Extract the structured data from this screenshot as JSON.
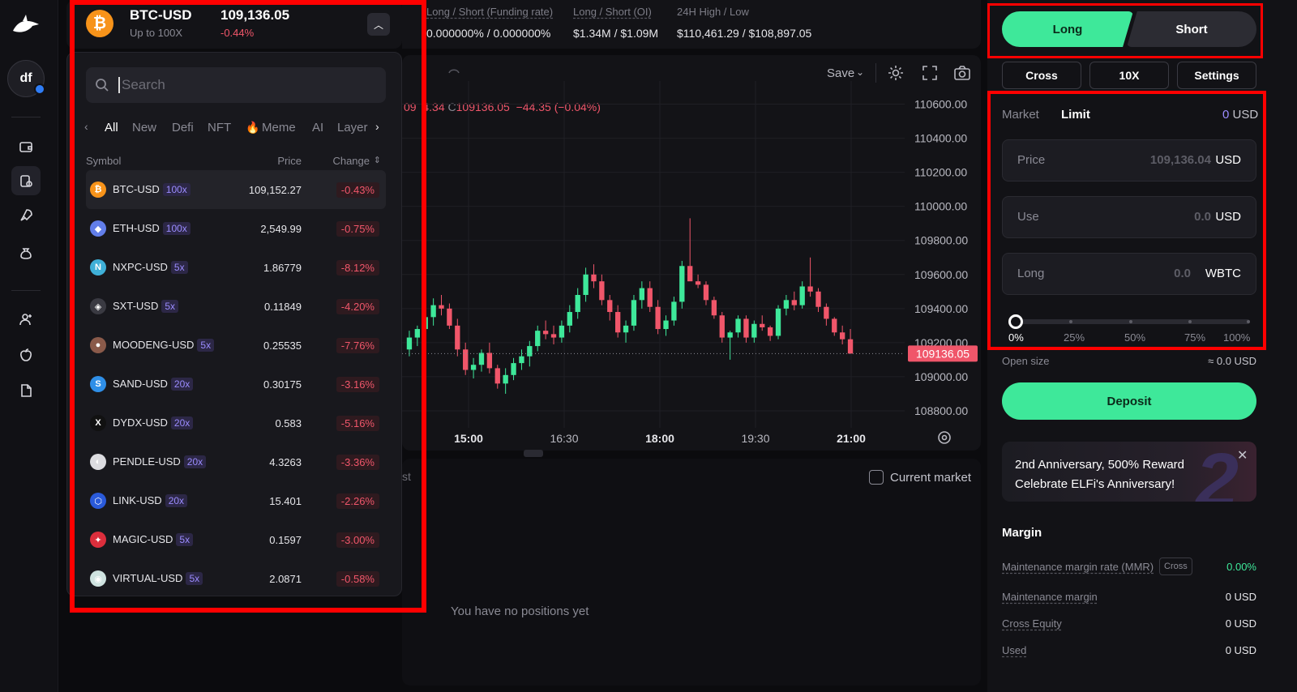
{
  "ticker": {
    "pair": "BTC-USD",
    "leverage": "Up to 100X",
    "price": "109,136.05",
    "change": "-0.44%",
    "coin_glyph": "₿"
  },
  "stats": [
    {
      "label": "Long / Short (Funding rate)",
      "value": "0.000000% / 0.000000%"
    },
    {
      "label": "Long / Short (OI)",
      "value": "$1.34M / $1.09M"
    },
    {
      "label": "24H High / Low",
      "value": "$110,461.29 / $108,897.05"
    }
  ],
  "chart": {
    "save_label": "Save",
    "ohlc_prefix": "09",
    "ohlc_low": "4.34",
    "ohlc_close_label": "C",
    "ohlc_close": "109136.05",
    "ohlc_delta": "−44.35 (−0.04%)",
    "last_price_tag": "109136.05"
  },
  "chart_data": {
    "type": "candlestick",
    "y_ticks": [
      "110600.00",
      "110400.00",
      "110200.00",
      "110000.00",
      "109800.00",
      "109600.00",
      "109400.00",
      "109200.00",
      "109000.00",
      "108800.00"
    ],
    "ylim": [
      108700,
      110650
    ],
    "x_ticks": [
      "15:00",
      "16:30",
      "18:00",
      "19:30",
      "21:00"
    ],
    "last_price": 109136.05,
    "candles": [
      [
        109160,
        109270,
        109120,
        109230
      ],
      [
        109230,
        109300,
        109180,
        109280
      ],
      [
        109280,
        109390,
        109240,
        109350
      ],
      [
        109350,
        109460,
        109300,
        109420
      ],
      [
        109420,
        109480,
        109360,
        109400
      ],
      [
        109400,
        109430,
        109280,
        109300
      ],
      [
        109300,
        109340,
        109120,
        109160
      ],
      [
        109160,
        109200,
        109010,
        109040
      ],
      [
        109040,
        109110,
        108990,
        109070
      ],
      [
        109070,
        109160,
        109030,
        109140
      ],
      [
        109140,
        109200,
        109020,
        109050
      ],
      [
        109050,
        109070,
        108930,
        108960
      ],
      [
        108960,
        109050,
        108900,
        109010
      ],
      [
        109010,
        109110,
        108980,
        109080
      ],
      [
        109080,
        109160,
        109040,
        109120
      ],
      [
        109120,
        109210,
        109060,
        109180
      ],
      [
        109180,
        109300,
        109150,
        109270
      ],
      [
        109270,
        109330,
        109220,
        109250
      ],
      [
        109250,
        109300,
        109190,
        109230
      ],
      [
        109230,
        109330,
        109200,
        109300
      ],
      [
        109300,
        109420,
        109260,
        109380
      ],
      [
        109380,
        109520,
        109340,
        109480
      ],
      [
        109480,
        109640,
        109440,
        109600
      ],
      [
        109600,
        109660,
        109520,
        109560
      ],
      [
        109560,
        109600,
        109420,
        109450
      ],
      [
        109450,
        109480,
        109330,
        109380
      ],
      [
        109380,
        109420,
        109230,
        109260
      ],
      [
        109260,
        109330,
        109200,
        109300
      ],
      [
        109300,
        109480,
        109270,
        109450
      ],
      [
        109450,
        109560,
        109400,
        109520
      ],
      [
        109520,
        109560,
        109380,
        109410
      ],
      [
        109410,
        109450,
        109250,
        109280
      ],
      [
        109280,
        109360,
        109240,
        109330
      ],
      [
        109330,
        109470,
        109300,
        109440
      ],
      [
        109440,
        109680,
        109400,
        109650
      ],
      [
        109650,
        109930,
        109600,
        109560
      ],
      [
        109560,
        109600,
        109520,
        109540
      ],
      [
        109540,
        109560,
        109420,
        109450
      ],
      [
        109450,
        109470,
        109340,
        109360
      ],
      [
        109360,
        109380,
        109200,
        109230
      ],
      [
        109230,
        109270,
        109100,
        109260
      ],
      [
        109260,
        109360,
        109230,
        109340
      ],
      [
        109340,
        109360,
        109200,
        109230
      ],
      [
        109230,
        109330,
        109200,
        109310
      ],
      [
        109310,
        109360,
        109270,
        109290
      ],
      [
        109290,
        109300,
        109210,
        109240
      ],
      [
        109240,
        109420,
        109220,
        109400
      ],
      [
        109400,
        109480,
        109360,
        109450
      ],
      [
        109450,
        109500,
        109390,
        109420
      ],
      [
        109420,
        109560,
        109400,
        109530
      ],
      [
        109530,
        109700,
        109470,
        109500
      ],
      [
        109500,
        109520,
        109380,
        109410
      ],
      [
        109410,
        109430,
        109300,
        109340
      ],
      [
        109340,
        109350,
        109240,
        109260
      ],
      [
        109260,
        109300,
        109190,
        109220
      ],
      [
        109220,
        109280,
        109150,
        109136
      ]
    ]
  },
  "dropdown": {
    "search_placeholder": "Search",
    "categories": [
      "All",
      "New",
      "Defi",
      "NFT",
      "Meme",
      "AI",
      "Layer"
    ],
    "header": {
      "symbol": "Symbol",
      "price": "Price",
      "change": "Change"
    },
    "rows": [
      {
        "symbol": "BTC-USD",
        "leverage": "100x",
        "price": "109,152.27",
        "change": "-0.43%",
        "color": "#f7931a",
        "glyph": "₿"
      },
      {
        "symbol": "ETH-USD",
        "leverage": "100x",
        "price": "2,549.99",
        "change": "-0.75%",
        "color": "#627eea",
        "glyph": "◆"
      },
      {
        "symbol": "NXPC-USD",
        "leverage": "5x",
        "price": "1.86779",
        "change": "-8.12%",
        "color": "#3fb0d8",
        "glyph": "N"
      },
      {
        "symbol": "SXT-USD",
        "leverage": "5x",
        "price": "0.11849",
        "change": "-4.20%",
        "color": "#3a3a42",
        "glyph": "◈"
      },
      {
        "symbol": "MOODENG-USD",
        "leverage": "5x",
        "price": "0.25535",
        "change": "-7.76%",
        "color": "#8a5a4a",
        "glyph": "●"
      },
      {
        "symbol": "SAND-USD",
        "leverage": "20x",
        "price": "0.30175",
        "change": "-3.16%",
        "color": "#2f8fe8",
        "glyph": "S"
      },
      {
        "symbol": "DYDX-USD",
        "leverage": "20x",
        "price": "0.583",
        "change": "-5.16%",
        "color": "#111111",
        "glyph": "X"
      },
      {
        "symbol": "PENDLE-USD",
        "leverage": "20x",
        "price": "4.3263",
        "change": "-3.36%",
        "color": "#dcdce0",
        "glyph": "◐"
      },
      {
        "symbol": "LINK-USD",
        "leverage": "20x",
        "price": "15.401",
        "change": "-2.26%",
        "color": "#2a5ada",
        "glyph": "⬡"
      },
      {
        "symbol": "MAGIC-USD",
        "leverage": "5x",
        "price": "0.1597",
        "change": "-3.00%",
        "color": "#dc2e3c",
        "glyph": "✦"
      },
      {
        "symbol": "VIRTUAL-USD",
        "leverage": "5x",
        "price": "2.0871",
        "change": "-0.58%",
        "color": "#cfe3e0",
        "glyph": "◉"
      }
    ]
  },
  "positions": {
    "fragment": "st",
    "current_market": "Current market",
    "empty": "You have no positions yet"
  },
  "user": {
    "initials": "df"
  },
  "trade": {
    "long": "Long",
    "short": "Short",
    "cross": "Cross",
    "leverage": "10X",
    "settings": "Settings",
    "market": "Market",
    "limit": "Limit",
    "balance_num": "0",
    "balance_unit": "USD",
    "fields": [
      {
        "label": "Price",
        "value": "109,136.04",
        "unit": "USD"
      },
      {
        "label": "Use",
        "value": "0.0",
        "unit": "USD"
      },
      {
        "label": "Long",
        "value": "0.0",
        "unit": "WBTC"
      }
    ],
    "slider_value_pct": 0,
    "slider_ticks": [
      "0%",
      "25%",
      "50%",
      "75%",
      "100%"
    ],
    "open_size_label": "Open size",
    "open_size_value": "≈ 0.0 USD",
    "deposit": "Deposit",
    "promo_line1": "2nd Anniversary, 500% Reward",
    "promo_line2": "Celebrate ELFi's Anniversary!",
    "promo_graphic": "2",
    "margin_title": "Margin",
    "margin_rows": [
      {
        "label": "Maintenance margin rate (MMR)",
        "value": "0.00%",
        "badge": "Cross"
      },
      {
        "label": "Maintenance margin",
        "value": "0 USD"
      },
      {
        "label": "Cross Equity",
        "value": "0 USD"
      },
      {
        "label": "Used",
        "value": "0 USD"
      }
    ]
  }
}
